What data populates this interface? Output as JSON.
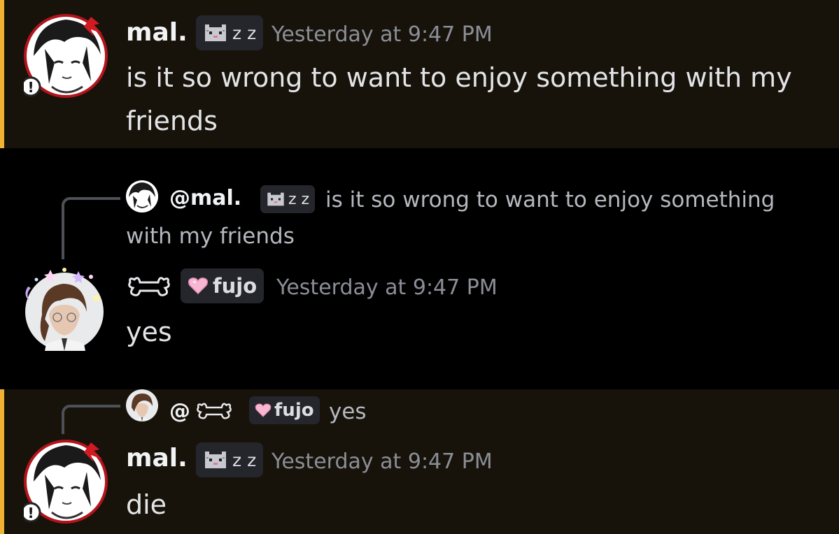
{
  "messages": [
    {
      "author": "mal.",
      "tag": "z z",
      "timestamp": "Yesterday at 9:47 PM",
      "text": "is it so wrong to want to enjoy something with my friends"
    },
    {
      "reply": {
        "author": "@mal.",
        "tag": "z z",
        "text": "is it so wrong to want to enjoy something with my friends"
      },
      "author_icon": "bone-icon",
      "tag": "fujo",
      "timestamp": "Yesterday at 9:47 PM",
      "text": "yes"
    },
    {
      "reply": {
        "author_prefix": "@",
        "author_icon": "bone-icon",
        "tag": "fujo",
        "text": "yes"
      },
      "author": "mal.",
      "tag": "z z",
      "timestamp": "Yesterday at 9:47 PM",
      "text": "die"
    }
  ],
  "colors": {
    "mention_bg": "#17130b",
    "mention_bar": "#f0b232",
    "background": "#000000",
    "timestamp": "#8b8e96"
  }
}
